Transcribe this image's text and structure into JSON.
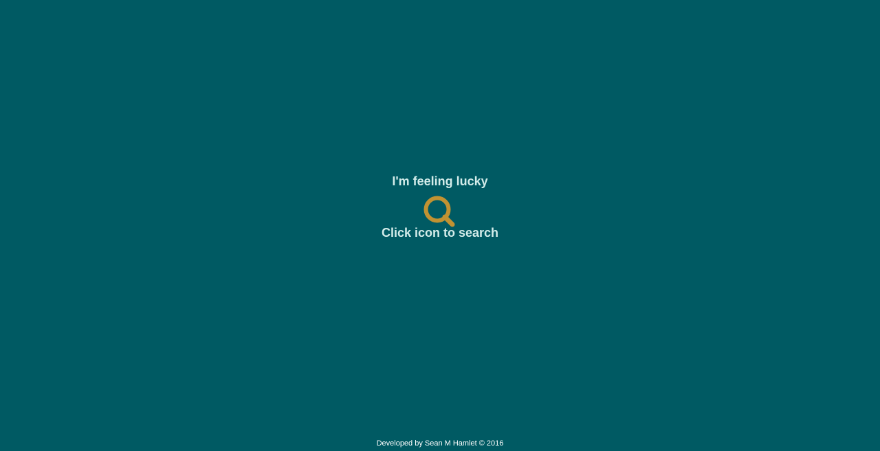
{
  "main": {
    "lucky_label": "I'm feeling lucky",
    "search_icon": "search-icon",
    "hint_text": "Click icon to search"
  },
  "footer": {
    "credit": "Developed by Sean M Hamlet © 2016"
  },
  "colors": {
    "background": "#005a63",
    "text": "#d3ecea",
    "icon": "#c19232"
  }
}
